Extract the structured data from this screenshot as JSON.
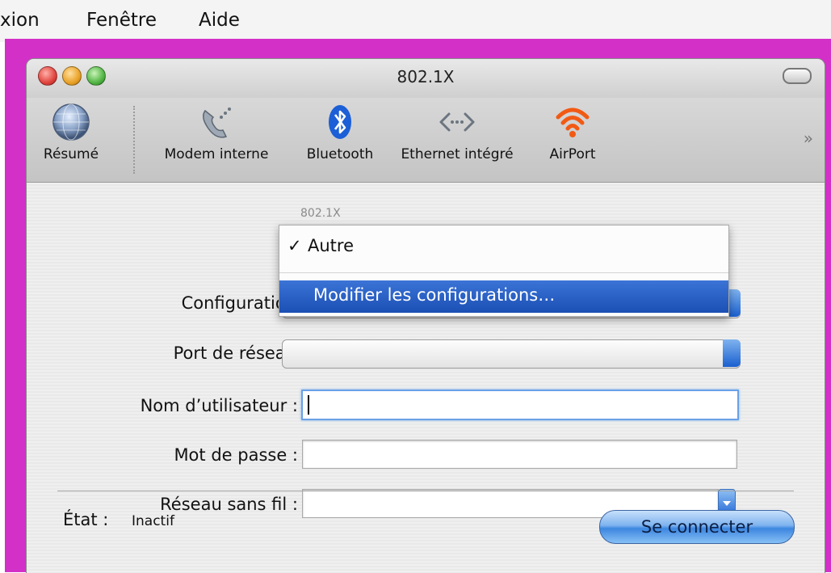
{
  "menubar": {
    "items": [
      {
        "label": "xion"
      },
      {
        "label": "Fenêtre"
      },
      {
        "label": "Aide"
      }
    ]
  },
  "window": {
    "title": "802.1X",
    "toolbar": {
      "items": [
        {
          "label": "Résumé",
          "icon": "globe-icon"
        },
        {
          "label": "Modem interne",
          "icon": "phone-icon"
        },
        {
          "label": "Bluetooth",
          "icon": "bluetooth-icon"
        },
        {
          "label": "Ethernet intégré",
          "icon": "ethernet-icon"
        },
        {
          "label": "AirPort",
          "icon": "wifi-icon"
        }
      ],
      "overflow": "»"
    }
  },
  "form": {
    "configuration": {
      "label": "Configuration",
      "value": "Autre"
    },
    "port": {
      "label": "Port de réseau"
    },
    "username": {
      "label": "Nom d’utilisateur :",
      "value": ""
    },
    "password": {
      "label": "Mot de passe :",
      "value": ""
    },
    "wireless": {
      "label": "Réseau sans fil :",
      "value": ""
    }
  },
  "dropdown": {
    "title": "802.1X",
    "checkmark": "✓",
    "items": [
      {
        "label": "Autre",
        "checked": true
      },
      {
        "label": "Modifier les configurations…",
        "highlighted": true
      }
    ]
  },
  "status": {
    "label": "État :",
    "value": "Inactif"
  },
  "buttons": {
    "connect": "Se connecter"
  },
  "colors": {
    "desktop": "#d330c8",
    "highlight": "#2a61c6",
    "close": "#e0443e",
    "minimize": "#e9a227",
    "zoom": "#52b545",
    "airport": "#f25a14",
    "bluetooth": "#1c5fd6"
  }
}
